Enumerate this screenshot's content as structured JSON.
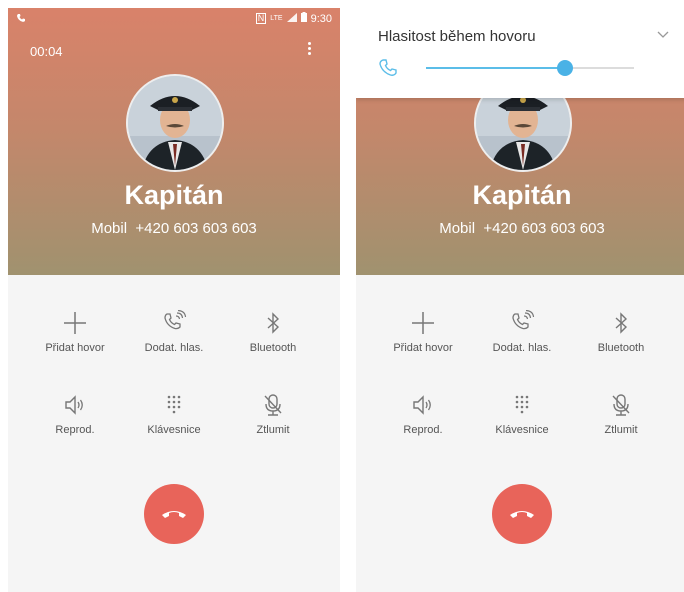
{
  "status_bar": {
    "time": "9:30"
  },
  "call": {
    "timer": "00:04",
    "contact_name": "Kapitán",
    "number_label": "Mobil",
    "number": "+420 603 603 603"
  },
  "controls": [
    {
      "label": "Přidat hovor",
      "icon": "add-call-icon"
    },
    {
      "label": "Dodat. hlas.",
      "icon": "extra-volume-icon"
    },
    {
      "label": "Bluetooth",
      "icon": "bluetooth-icon"
    },
    {
      "label": "Reprod.",
      "icon": "speaker-icon"
    },
    {
      "label": "Klávesnice",
      "icon": "keypad-icon"
    },
    {
      "label": "Ztlumit",
      "icon": "mute-mic-icon"
    }
  ],
  "volume_panel": {
    "title": "Hlasitost během hovoru",
    "level": 0.67
  },
  "colors": {
    "accent": "#4ab2e6",
    "end_call": "#e8645a",
    "hero_top": "#d9826a",
    "hero_bottom": "#a0926f"
  }
}
